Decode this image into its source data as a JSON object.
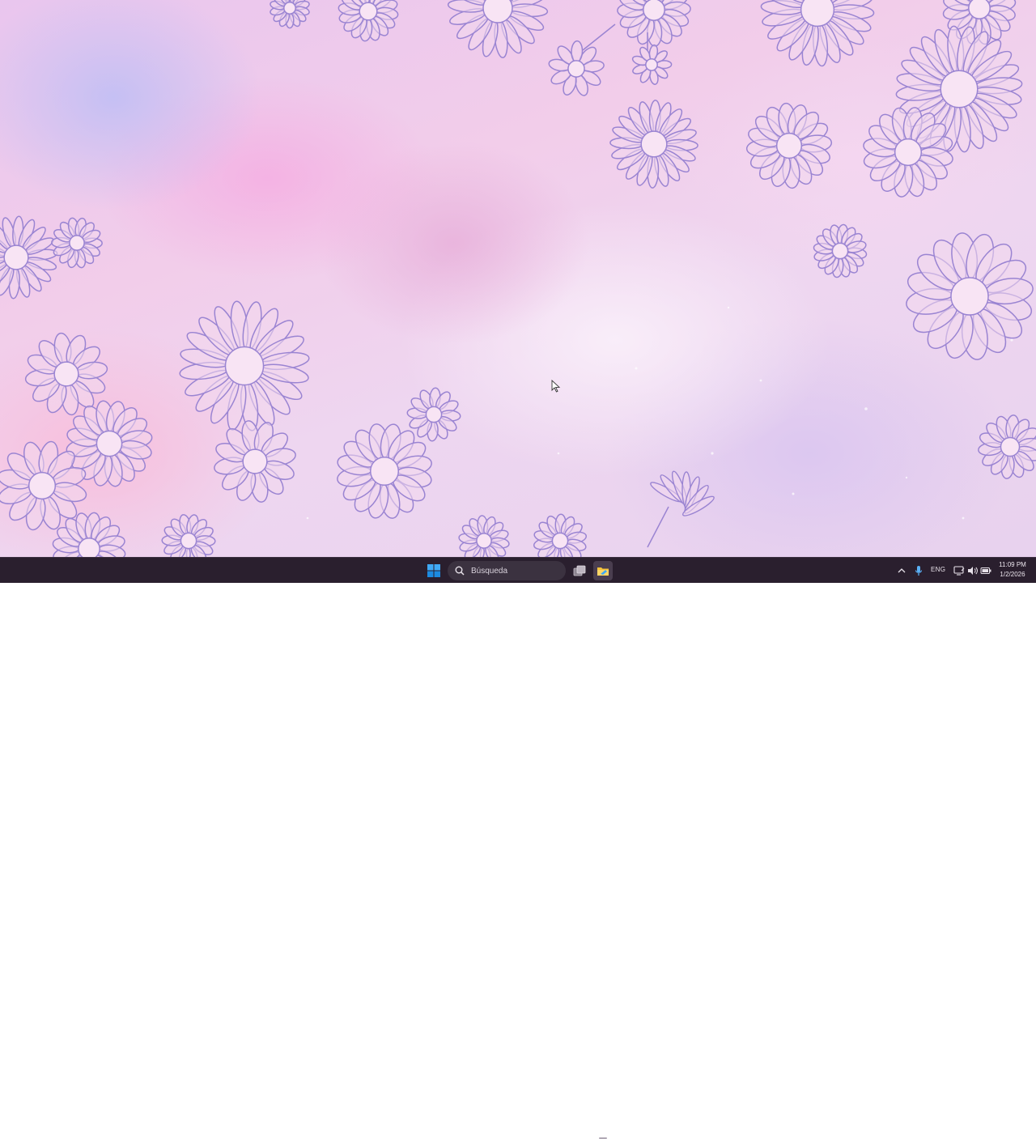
{
  "desktop": {
    "wallpaper": "pastel pink sky with lavender daisy doodles",
    "colors": {
      "flower_stroke": "#9a84d2",
      "flower_fill": "#f3d8ef",
      "center_fill": "#f8e4f4"
    }
  },
  "taskbar": {
    "start_icon": "windows-logo-icon",
    "search": {
      "placeholder": "Búsqueda",
      "icon": "search-icon"
    },
    "task_view_icon": "task-view-icon",
    "pinned_app_icon": "file-explorer-icon",
    "tray": {
      "chevron_icon": "chevron-up-icon",
      "mic_icon": "microphone-icon",
      "language": "ENG",
      "network_icon": "network-icon",
      "volume_icon": "speaker-icon",
      "battery_icon": "battery-icon"
    },
    "clock": {
      "time": "11:09 PM",
      "date": "1/2/2026"
    },
    "colors": {
      "background": "#2a1f2e",
      "accent": "#0078d4"
    }
  }
}
